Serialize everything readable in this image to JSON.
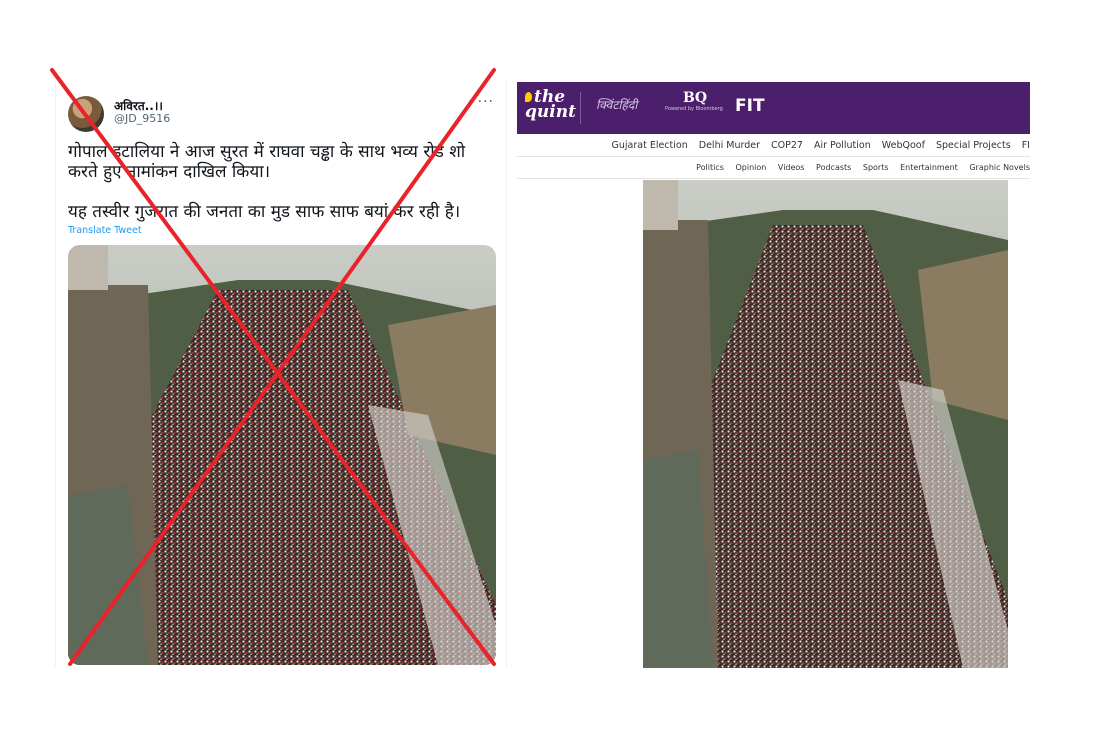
{
  "tweet": {
    "username": "अविरत..।।",
    "handle": "@JD_9516",
    "more_label": "···",
    "text_line1": "गोपाल इटालिया ने आज सुरत में राघवा चड्ढा के साथ भव्य रोड शो करते हुए नामांकन दाखिल किया।",
    "text_line2": "यह तस्वीर गुजरात की जनता का मुड साफ साफ बयां कर रही है।",
    "translate_label": "Translate Tweet"
  },
  "overlay": {
    "cross_color": "#e8232a"
  },
  "quint": {
    "brand_color": "#4b1f6b",
    "logo_text_1": "the",
    "logo_text_2": "quint",
    "hindi_brand": "क्विंटहिंदी",
    "bq_brand": "BQ",
    "bq_sub": "Powered by Bloomberg",
    "fit_brand": "FIT",
    "nav_primary": [
      "Gujarat Election",
      "Delhi Murder",
      "COP27",
      "Air Pollution",
      "WebQoof",
      "Special Projects",
      "FI"
    ],
    "nav_secondary": [
      "Politics",
      "Opinion",
      "Videos",
      "Podcasts",
      "Sports",
      "Entertainment",
      "Graphic Novels"
    ]
  }
}
